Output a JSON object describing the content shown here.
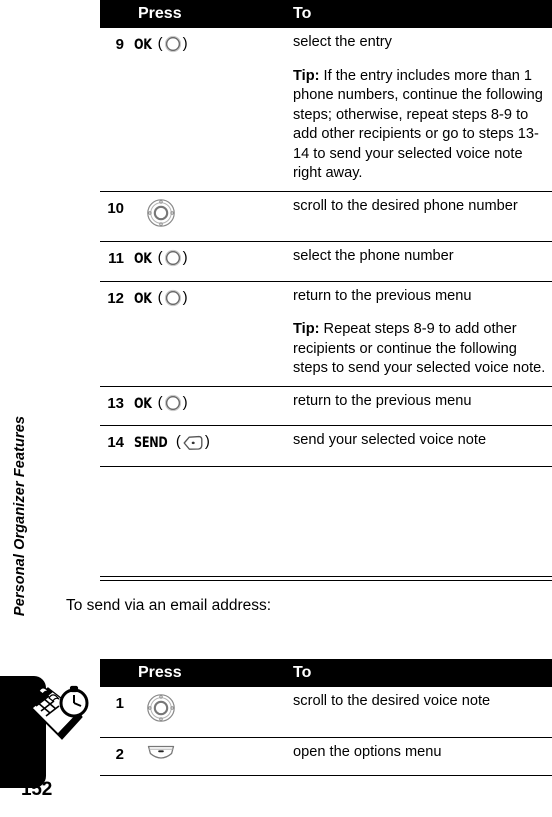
{
  "page": {
    "folio": "152",
    "running_head": "Personal Organizer Features",
    "tab_icon": "organizer-stopwatch-icon"
  },
  "intro_text": "To send via an email address:",
  "tables": [
    {
      "id": "send-via-phone-number",
      "headers": {
        "num": "",
        "press": "Press",
        "to": "To"
      },
      "rows": [
        {
          "num": "9",
          "press_key": "OK",
          "press_icon": "ok-key-icon",
          "to_lines": [
            {
              "type": "plain",
              "text": "select the entry"
            },
            {
              "type": "tip",
              "lead": "Tip:",
              "text": " If the entry includes more than 1 phone numbers, continue the following steps; otherwise, repeat steps 8-9 to add other recipients or go to steps 13-14 to send your selected voice note right away."
            }
          ]
        },
        {
          "num": "10",
          "press_key": "",
          "press_icon": "navigation-key-icon",
          "to_lines": [
            {
              "type": "plain",
              "text": "scroll to the desired phone number"
            }
          ]
        },
        {
          "num": "11",
          "press_key": "OK",
          "press_icon": "ok-key-icon",
          "to_lines": [
            {
              "type": "plain",
              "text": "select the phone number"
            }
          ]
        },
        {
          "num": "12",
          "press_key": "OK",
          "press_icon": "ok-key-icon",
          "to_lines": [
            {
              "type": "plain",
              "text": "return to the previous menu"
            },
            {
              "type": "tip",
              "lead": "Tip:",
              "text": " Repeat steps 8-9 to add other recipients or continue the following steps to send your selected voice note."
            }
          ]
        },
        {
          "num": "13",
          "press_key": "OK",
          "press_icon": "ok-key-icon",
          "to_lines": [
            {
              "type": "plain",
              "text": "return to the previous menu"
            }
          ]
        },
        {
          "num": "14",
          "press_key": "SEND",
          "press_icon": "send-key-icon",
          "to_lines": [
            {
              "type": "plain",
              "text": "send your selected voice note"
            }
          ]
        }
      ]
    },
    {
      "id": "send-via-email-address",
      "headers": {
        "num": "",
        "press": "Press",
        "to": "To"
      },
      "rows": [
        {
          "num": "1",
          "press_key": "",
          "press_icon": "navigation-key-icon",
          "to_lines": [
            {
              "type": "plain",
              "text": "scroll to the desired voice note"
            }
          ]
        },
        {
          "num": "2",
          "press_key": "",
          "press_icon": "softkey-menu-icon",
          "to_lines": [
            {
              "type": "plain",
              "text": "open the options menu"
            }
          ]
        }
      ]
    }
  ],
  "colors": {
    "header_bg": "#000000",
    "header_fg": "#ffffff",
    "rule": "#000000",
    "text": "#000000",
    "page_bg": "#ffffff"
  }
}
